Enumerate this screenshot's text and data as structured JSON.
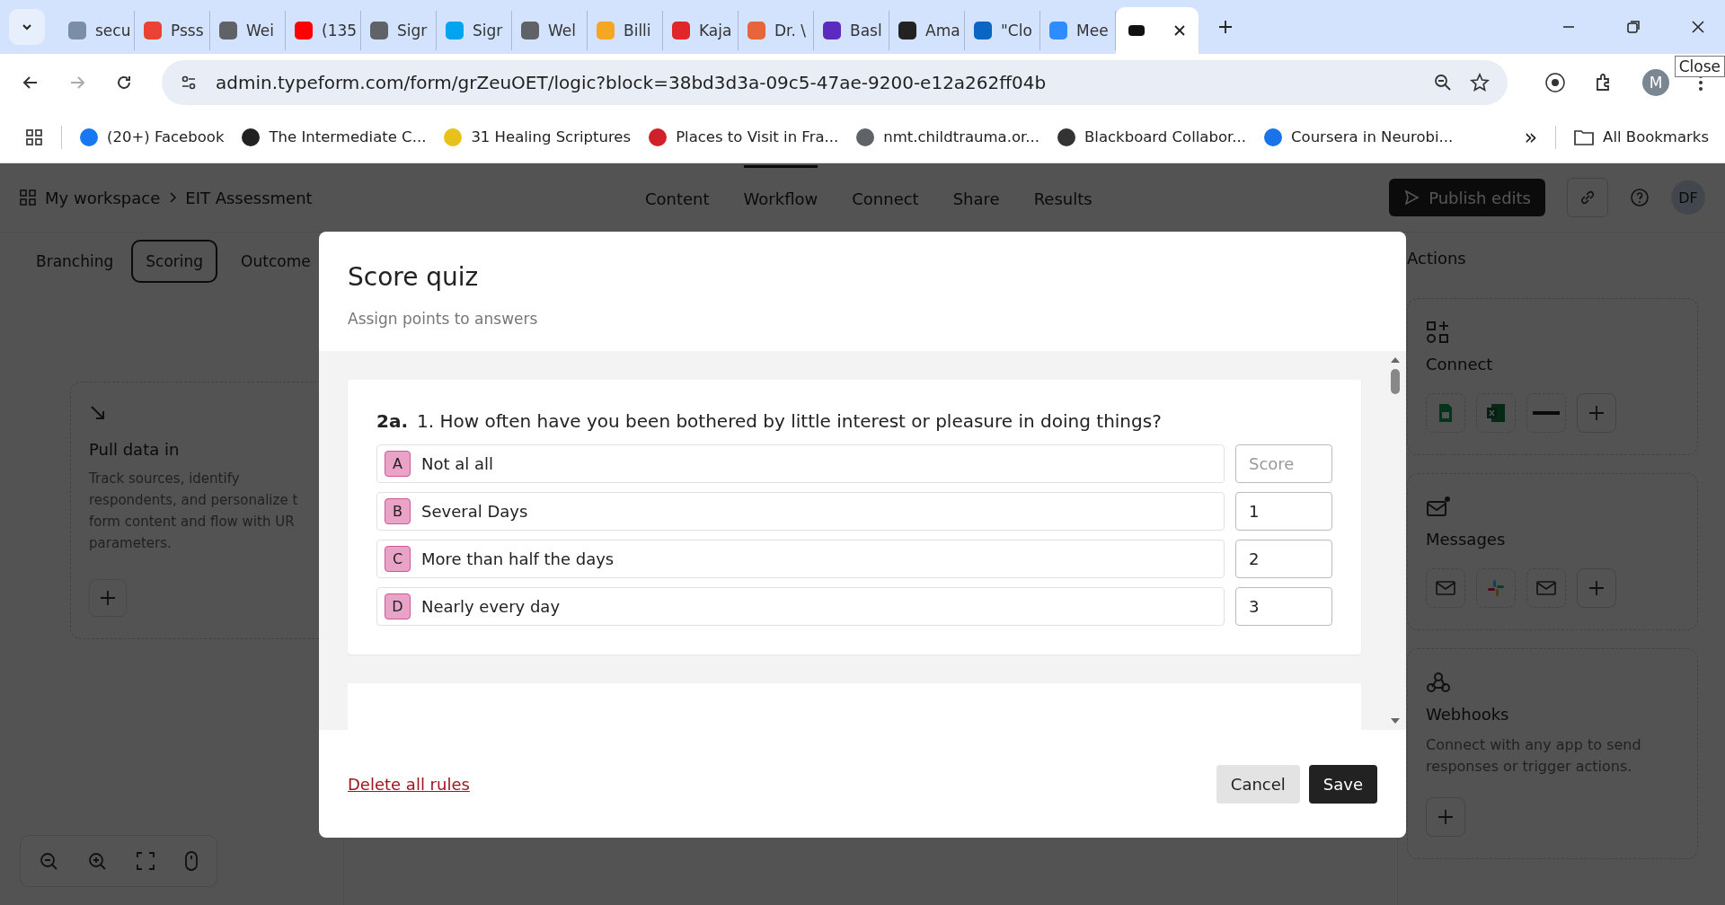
{
  "browser": {
    "tabs": [
      {
        "title": "secu",
        "color": "#7a8fa6",
        "selected": false
      },
      {
        "title": "Psss",
        "color": "#ea4335",
        "selected": false
      },
      {
        "title": "Wei",
        "color": "#5f6368",
        "selected": false
      },
      {
        "title": "(135",
        "color": "#ff0000",
        "selected": false
      },
      {
        "title": "Sigr",
        "color": "#5f6368",
        "selected": false
      },
      {
        "title": "Sigr",
        "color": "#00a4ef",
        "selected": false
      },
      {
        "title": "Wel",
        "color": "#5f6368",
        "selected": false
      },
      {
        "title": "Billi",
        "color": "#f5a623",
        "selected": false
      },
      {
        "title": "Kaja",
        "color": "#e0262a",
        "selected": false
      },
      {
        "title": "Dr. \\",
        "color": "#e8643c",
        "selected": false
      },
      {
        "title": "Basl",
        "color": "#5b2bbf",
        "selected": false
      },
      {
        "title": "Ama",
        "color": "#222222",
        "selected": false
      },
      {
        "title": "\"Clo",
        "color": "#0a66c2",
        "selected": false
      },
      {
        "title": "Mee",
        "color": "#2d8cff",
        "selected": false
      },
      {
        "color": "#111111",
        "selected": true
      }
    ],
    "tooltip": "Close",
    "url": "admin.typeform.com/form/grZeuOET/logic?block=38bd3d3a-09c5-47ae-9200-e12a262ff04b",
    "profile": "M",
    "bookmarks": [
      {
        "title": "(20+) Facebook",
        "color": "#1877f2"
      },
      {
        "title": "The Intermediate C...",
        "color": "#222222"
      },
      {
        "title": "31 Healing Scriptures",
        "color": "#e8c21a"
      },
      {
        "title": "Places to Visit in Fra...",
        "color": "#d0202a"
      },
      {
        "title": "nmt.childtrauma.or...",
        "color": "#5f6368"
      },
      {
        "title": "Blackboard Collabor...",
        "color": "#333333"
      },
      {
        "title": "Coursera in Neurobi...",
        "color": "#1a73e8"
      }
    ],
    "overflow": "»",
    "all_bookmarks": "All Bookmarks"
  },
  "app": {
    "workspace": "My workspace",
    "form": "EIT Assessment",
    "nav": [
      {
        "label": "Content",
        "selected": false
      },
      {
        "label": "Workflow",
        "selected": true
      },
      {
        "label": "Connect",
        "selected": false
      },
      {
        "label": "Share",
        "selected": false
      },
      {
        "label": "Results",
        "selected": false
      }
    ],
    "publish": "Publish edits",
    "avatar": "DF",
    "subtabs": [
      {
        "label": "Branching",
        "selected": false
      },
      {
        "label": "Scoring",
        "selected": true
      },
      {
        "label": "Outcome",
        "selected": false
      }
    ],
    "pull": {
      "title": "Pull data in",
      "description": "Track sources, identify\nrespondents, and personalize t\nform content and flow with UR\nparameters."
    },
    "actions": {
      "title": "Actions",
      "cards": [
        {
          "kind": "connect",
          "title": "Connect"
        },
        {
          "kind": "messages",
          "title": "Messages"
        },
        {
          "kind": "webhooks",
          "title": "Webhooks",
          "description": "Connect with any app to send responses or trigger actions."
        }
      ]
    }
  },
  "modal": {
    "title": "Score quiz",
    "subtitle": "Assign points to answers",
    "question": {
      "number": "2a.",
      "text": "1. How often have you been bothered by little interest or pleasure in doing things?"
    },
    "answers": [
      {
        "letter": "A",
        "label": "Not al all",
        "placeholder": "Score"
      },
      {
        "letter": "B",
        "label": "Several Days",
        "score": "1"
      },
      {
        "letter": "C",
        "label": "More than half the days",
        "score": "2"
      },
      {
        "letter": "D",
        "label": "Nearly every day",
        "score": "3"
      }
    ],
    "delete": "Delete all rules",
    "cancel": "Cancel",
    "save": "Save"
  }
}
